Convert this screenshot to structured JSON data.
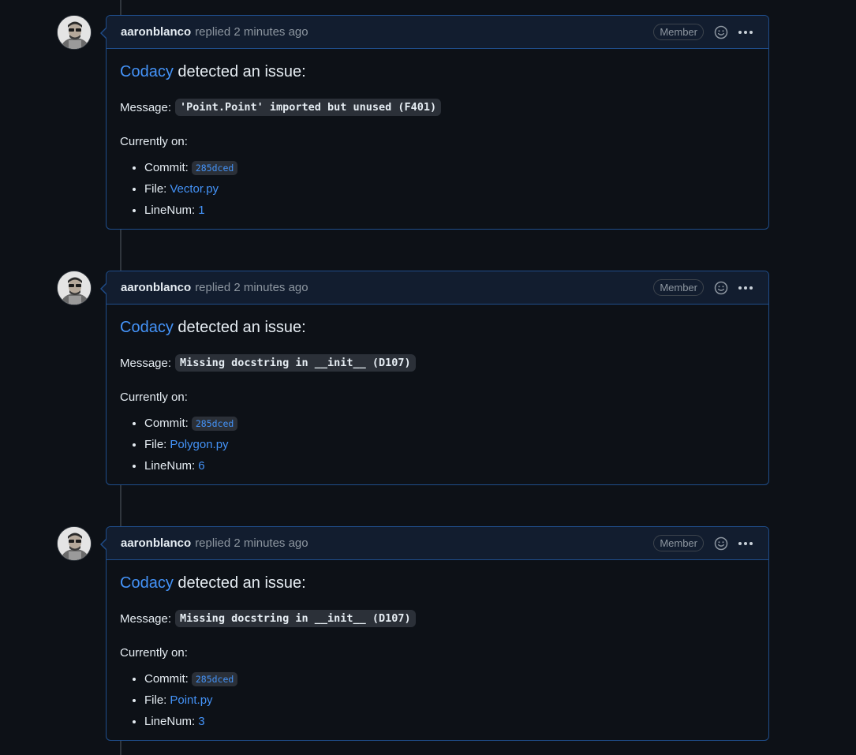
{
  "comments": [
    {
      "author": "aaronblanco",
      "action": "replied 2 minutes ago",
      "badge": "Member",
      "tool": "Codacy",
      "detected_text": "detected an issue:",
      "message_label": "Message:",
      "message_code": "'Point.Point' imported but unused (F401)",
      "currently_label": "Currently on:",
      "commit_label": "Commit:",
      "commit": "285dced",
      "file_label": "File:",
      "file": "Vector.py",
      "linenum_label": "LineNum:",
      "linenum": "1"
    },
    {
      "author": "aaronblanco",
      "action": "replied 2 minutes ago",
      "badge": "Member",
      "tool": "Codacy",
      "detected_text": "detected an issue:",
      "message_label": "Message:",
      "message_code": "Missing docstring in __init__ (D107)",
      "currently_label": "Currently on:",
      "commit_label": "Commit:",
      "commit": "285dced",
      "file_label": "File:",
      "file": "Polygon.py",
      "linenum_label": "LineNum:",
      "linenum": "6"
    },
    {
      "author": "aaronblanco",
      "action": "replied 2 minutes ago",
      "badge": "Member",
      "tool": "Codacy",
      "detected_text": "detected an issue:",
      "message_label": "Message:",
      "message_code": "Missing docstring in __init__ (D107)",
      "currently_label": "Currently on:",
      "commit_label": "Commit:",
      "commit": "285dced",
      "file_label": "File:",
      "file": "Point.py",
      "linenum_label": "LineNum:",
      "linenum": "3"
    }
  ],
  "colors": {
    "background": "#0d1117",
    "card_border": "#1f4d8a",
    "header_bg": "#121d2f",
    "link": "#4493f8",
    "muted": "#8d96a0"
  },
  "icons": {
    "reaction": "smiley-icon",
    "menu": "kebab-horizontal-icon"
  }
}
